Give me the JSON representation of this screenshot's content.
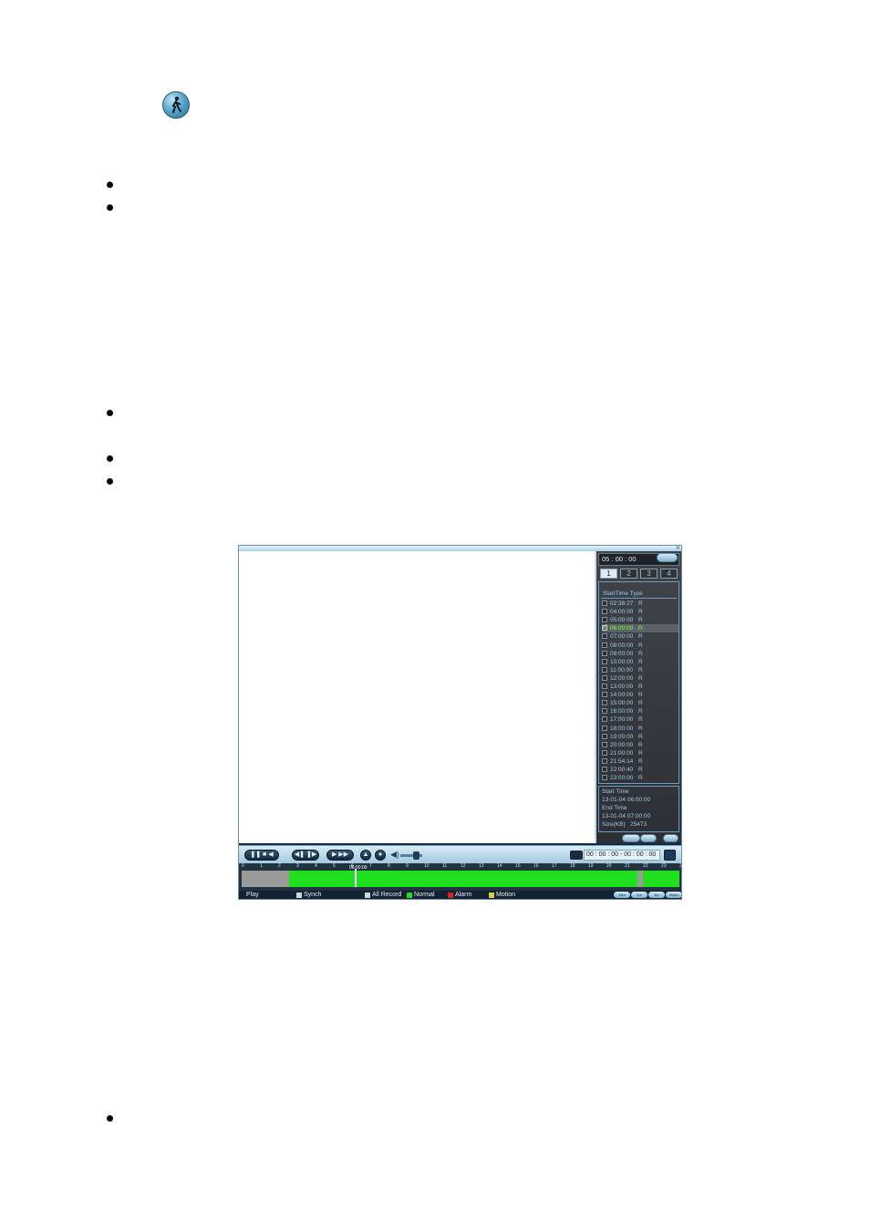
{
  "player": {
    "close_glyph": "×",
    "side": {
      "time_input": "05 : 00 : 00",
      "channels": [
        "1",
        "2",
        "3",
        "4"
      ],
      "active_channel": "1",
      "list_header": "StartTime Type",
      "files": [
        {
          "time": "02:38:27",
          "type": "R"
        },
        {
          "time": "04:00:00",
          "type": "R"
        },
        {
          "time": "05:00:00",
          "type": "R"
        },
        {
          "time": "06:00:00",
          "type": "R",
          "selected": true
        },
        {
          "time": "07:00:00",
          "type": "R"
        },
        {
          "time": "08:00:00",
          "type": "R"
        },
        {
          "time": "09:00:00",
          "type": "R"
        },
        {
          "time": "10:00:00",
          "type": "R"
        },
        {
          "time": "11:00:00",
          "type": "R"
        },
        {
          "time": "12:00:00",
          "type": "R"
        },
        {
          "time": "13:00:00",
          "type": "R"
        },
        {
          "time": "14:00:00",
          "type": "R"
        },
        {
          "time": "15:00:00",
          "type": "R"
        },
        {
          "time": "16:00:00",
          "type": "R"
        },
        {
          "time": "17:00:00",
          "type": "R"
        },
        {
          "time": "18:00:00",
          "type": "R"
        },
        {
          "time": "19:00:00",
          "type": "R"
        },
        {
          "time": "20:00:00",
          "type": "R"
        },
        {
          "time": "21:00:00",
          "type": "R"
        },
        {
          "time": "21:54:14",
          "type": "R"
        },
        {
          "time": "22:00:40",
          "type": "R"
        },
        {
          "time": "23:00:00",
          "type": "R"
        }
      ],
      "info": {
        "start_label": "Start Time",
        "start_value": "13-01-04  06:00:00",
        "end_label": "End Time",
        "end_value": "13-01-04  07:00:00",
        "size_label": "Size(KB)",
        "size_value": "25473"
      }
    },
    "controls": {
      "time_range": "00 : 00 : 00   -  00 : 00 : 00"
    },
    "timeline": {
      "hours": [
        "0",
        "1",
        "2",
        "3",
        "4",
        "5",
        "6",
        "7",
        "8",
        "9",
        "10",
        "11",
        "12",
        "13",
        "14",
        "15",
        "16",
        "17",
        "18",
        "19",
        "20",
        "21",
        "22",
        "23",
        "24"
      ],
      "cursor_label": "06:00:00"
    },
    "status": {
      "play": "Play",
      "synch": "Synch",
      "all_record": "All Record",
      "normal": "Normal",
      "alarm": "Alarm",
      "motion": "Motion",
      "zoom": [
        "24hr",
        "2hr",
        "1hr",
        "30min"
      ]
    },
    "colors": {
      "record_normal": "#1ee01e",
      "alarm": "#e02020",
      "motion": "#d8d040"
    }
  }
}
